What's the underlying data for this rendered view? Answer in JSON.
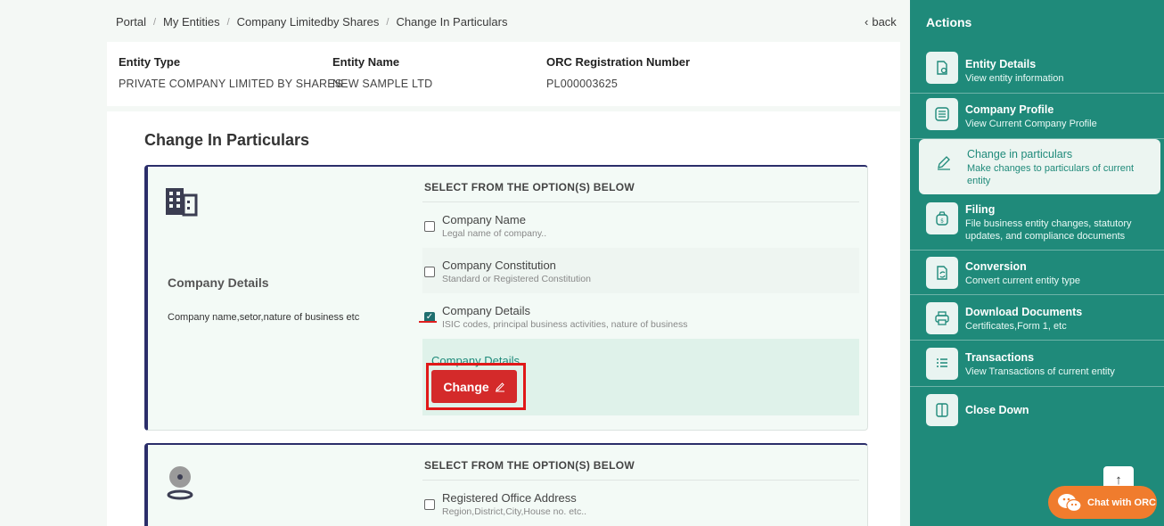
{
  "breadcrumb": [
    "Portal",
    "My Entities",
    "Company Limitedby Shares",
    "Change In Particulars"
  ],
  "back_label": "back",
  "entity": {
    "type_label": "Entity Type",
    "type_value": "PRIVATE COMPANY LIMITED BY SHARES",
    "name_label": "Entity Name",
    "name_value": "NEW SAMPLE LTD",
    "orc_label": "ORC Registration Number",
    "orc_value": "PL000003625"
  },
  "page_title": "Change In Particulars",
  "sections": [
    {
      "title": "Company Details",
      "description": "Company name,setor,nature of business etc",
      "icon": "building-icon",
      "options_header": "SELECT FROM THE OPTION(S) BELOW",
      "options": [
        {
          "name": "Company Name",
          "sub": "Legal name of company..",
          "checked": false
        },
        {
          "name": "Company Constitution",
          "sub": "Standard or Registered Constitution",
          "checked": false
        },
        {
          "name": "Company Details",
          "sub": "ISIC codes, principal business activities, nature of business",
          "checked": true
        }
      ],
      "change_panel_title": "Company Details",
      "change_button": "Change"
    },
    {
      "icon": "location-pin-icon",
      "options_header": "SELECT FROM THE OPTION(S) BELOW",
      "options": [
        {
          "name": "Registered Office Address",
          "sub": "Region,District,City,House no. etc..",
          "checked": false
        }
      ]
    }
  ],
  "sidebar": {
    "title": "Actions",
    "items": [
      {
        "name": "Entity Details",
        "sub": "View entity information",
        "icon": "document-view-icon"
      },
      {
        "name": "Company Profile",
        "sub": "View Current Company Profile",
        "icon": "list-icon"
      },
      {
        "name": "Change in particulars",
        "sub": "Make changes to particulars of current entity",
        "icon": "pencil-icon",
        "active": true
      },
      {
        "name": "Filing",
        "sub": "File business entity changes, statutory updates, and compliance documents",
        "icon": "money-bag-icon"
      },
      {
        "name": "Conversion",
        "sub": "Convert current entity type",
        "icon": "convert-icon"
      },
      {
        "name": "Download Documents",
        "sub": "Certificates,Form 1, etc",
        "icon": "printer-icon"
      },
      {
        "name": "Transactions",
        "sub": "View Transactions of current entity",
        "icon": "transactions-list-icon"
      },
      {
        "name": "Close Down",
        "sub": "",
        "icon": "door-icon"
      }
    ]
  },
  "chat_label": "Chat with ORC",
  "colors": {
    "accent": "#1f8a7a",
    "danger": "#d42a2a",
    "navy": "#2b2e6a",
    "chat": "#f07c2d"
  }
}
